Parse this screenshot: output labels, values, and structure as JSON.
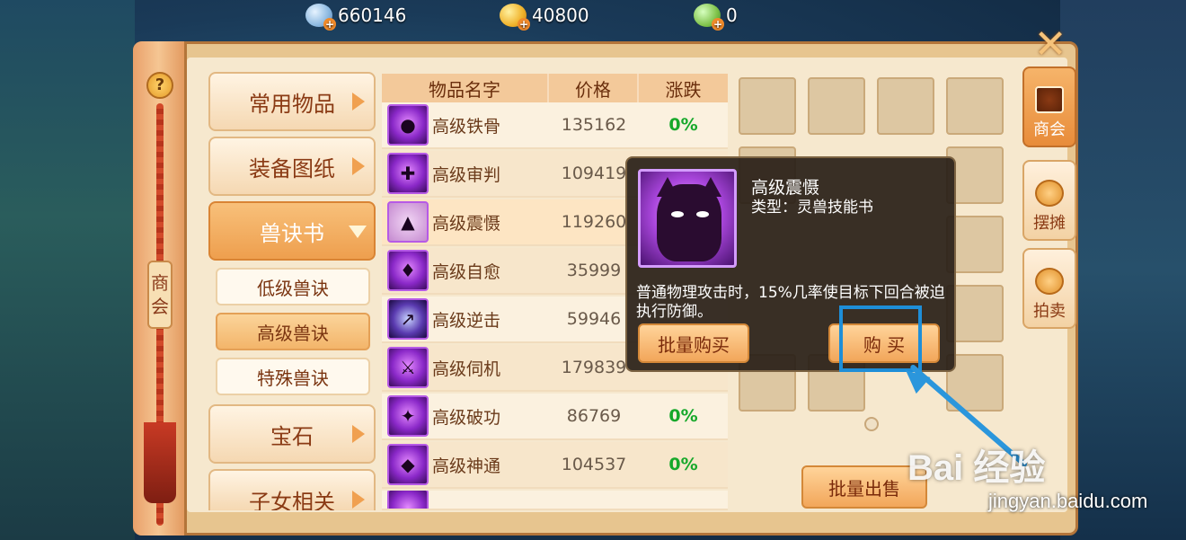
{
  "currency": [
    {
      "icon": "silver-coin-icon",
      "value": "660146"
    },
    {
      "icon": "gold-coin-icon",
      "value": "40800"
    },
    {
      "icon": "jade-coin-icon",
      "value": "0"
    }
  ],
  "left_panel": {
    "help": "?",
    "title": "商会"
  },
  "categories": [
    {
      "label": "常用物品"
    },
    {
      "label": "装备图纸"
    },
    {
      "label": "兽诀书"
    },
    {
      "label": "宝石"
    },
    {
      "label": "子女相关"
    }
  ],
  "subcategories": [
    {
      "label": "低级兽诀"
    },
    {
      "label": "高级兽诀"
    },
    {
      "label": "特殊兽诀"
    }
  ],
  "table": {
    "headers": {
      "name": "物品名字",
      "price": "价格",
      "change": "涨跌"
    },
    "rows": [
      {
        "name": "高级铁骨",
        "price": "135162",
        "change": "0%"
      },
      {
        "name": "高级审判",
        "price": "109419",
        "change": ""
      },
      {
        "name": "高级震慑",
        "price": "119260",
        "change": ""
      },
      {
        "name": "高级自愈",
        "price": "35999",
        "change": ""
      },
      {
        "name": "高级逆击",
        "price": "59946",
        "change": ""
      },
      {
        "name": "高级伺机",
        "price": "179839",
        "change": ""
      },
      {
        "name": "高级破功",
        "price": "86769",
        "change": "0%"
      },
      {
        "name": "高级神通",
        "price": "104537",
        "change": "0%"
      }
    ]
  },
  "popup": {
    "title": "高级震慑",
    "type": "类型：灵兽技能书",
    "description": "普通物理攻击时，15%几率使目标下回合被迫执行防御。",
    "bulk_buy": "批量购买",
    "buy": "购 买"
  },
  "sell_button": "批量出售",
  "right_tabs": [
    {
      "label": "商会",
      "icon": "guild-icon"
    },
    {
      "label": "摆摊",
      "icon": "stall-icon"
    },
    {
      "label": "拍卖",
      "icon": "auction-icon"
    }
  ],
  "watermark": {
    "logo": "Bai 经验",
    "url": "jingyan.baidu.com"
  },
  "colors": {
    "accent": "#f2a65a",
    "highlight": "#1e8ed8",
    "positive": "#16a82a"
  }
}
